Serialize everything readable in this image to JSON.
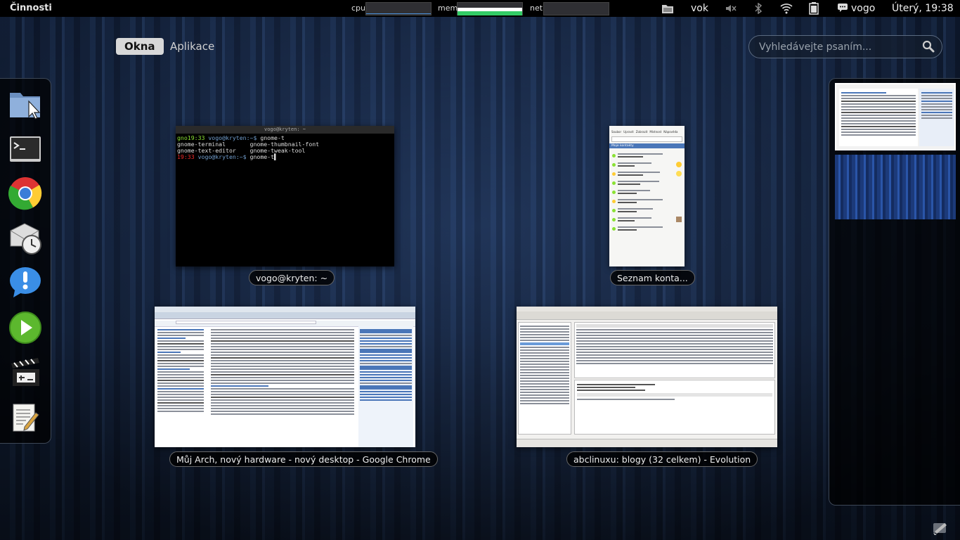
{
  "topbar": {
    "activities": "Činnosti",
    "monitors": [
      {
        "label": "cpu"
      },
      {
        "label": "mem"
      },
      {
        "label": "net"
      }
    ],
    "keyboard_layout": "vok",
    "user": "vogo",
    "clock": "Úterý, 19:38"
  },
  "tabs": [
    {
      "label": "Okna",
      "active": true
    },
    {
      "label": "Aplikace",
      "active": false
    }
  ],
  "search": {
    "placeholder": "Vyhledávejte psaním..."
  },
  "dash": {
    "items": [
      {
        "icon": "file-manager-icon"
      },
      {
        "icon": "terminal-icon"
      },
      {
        "icon": "chrome-icon"
      },
      {
        "icon": "evolution-mail-icon"
      },
      {
        "icon": "empathy-chat-icon"
      },
      {
        "icon": "media-player-icon"
      },
      {
        "icon": "video-editor-icon"
      },
      {
        "icon": "text-editor-icon"
      }
    ]
  },
  "windows": [
    {
      "title": "vogo@kryten: ~",
      "app": "terminal"
    },
    {
      "title": "Seznam konta...",
      "app": "contact-list"
    },
    {
      "title": "Můj Arch, nový hardware - nový desktop - Google Chrome",
      "app": "chrome"
    },
    {
      "title": "abclinuxu: blogy (32 celkem) - Evolution",
      "app": "evolution"
    }
  ],
  "terminal": {
    "title": "vogo@kryten: ~",
    "line1_time": "gno19:33",
    "line1_user": "vogo@kryten:~$",
    "line1_cmd": " gnome-t",
    "line2": "gnome-terminal       gnome-thumbnail-font",
    "line3": "gnome-text-editor    gnome-tweak-tool",
    "line4_time": "19:33",
    "line4_user": "vogo@kryten:~$",
    "line4_cmd": " gnome-t"
  },
  "contacts": {
    "menu": [
      "Soubor",
      "Upravit",
      "Zobrazit",
      "Místnost",
      "Nápověda"
    ],
    "header": "Moje kontakty"
  },
  "colors": {
    "accent": "#4a90d9",
    "topbar": "#000000",
    "mem_bar": "#33cc66"
  }
}
